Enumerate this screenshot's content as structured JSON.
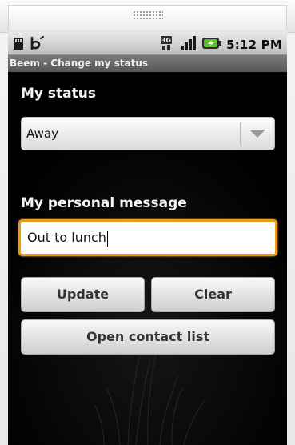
{
  "status_bar": {
    "time": "5:12 PM",
    "left_icons": [
      "sd-card-icon",
      "beem-logo-icon"
    ],
    "right_icons": [
      "3g-data-icon",
      "signal-strength-icon",
      "battery-charging-icon"
    ]
  },
  "app": {
    "title": "Beem - Change my status"
  },
  "form": {
    "status_label": "My status",
    "status_value": "Away",
    "message_label": "My personal message",
    "message_value": "Out to lunch"
  },
  "buttons": {
    "update_label": "Update",
    "clear_label": "Clear",
    "open_contacts_label": "Open contact list"
  },
  "colors": {
    "focus_border": "#f09a1a",
    "background": "#000000",
    "title_bar": "#5e5e5e"
  }
}
